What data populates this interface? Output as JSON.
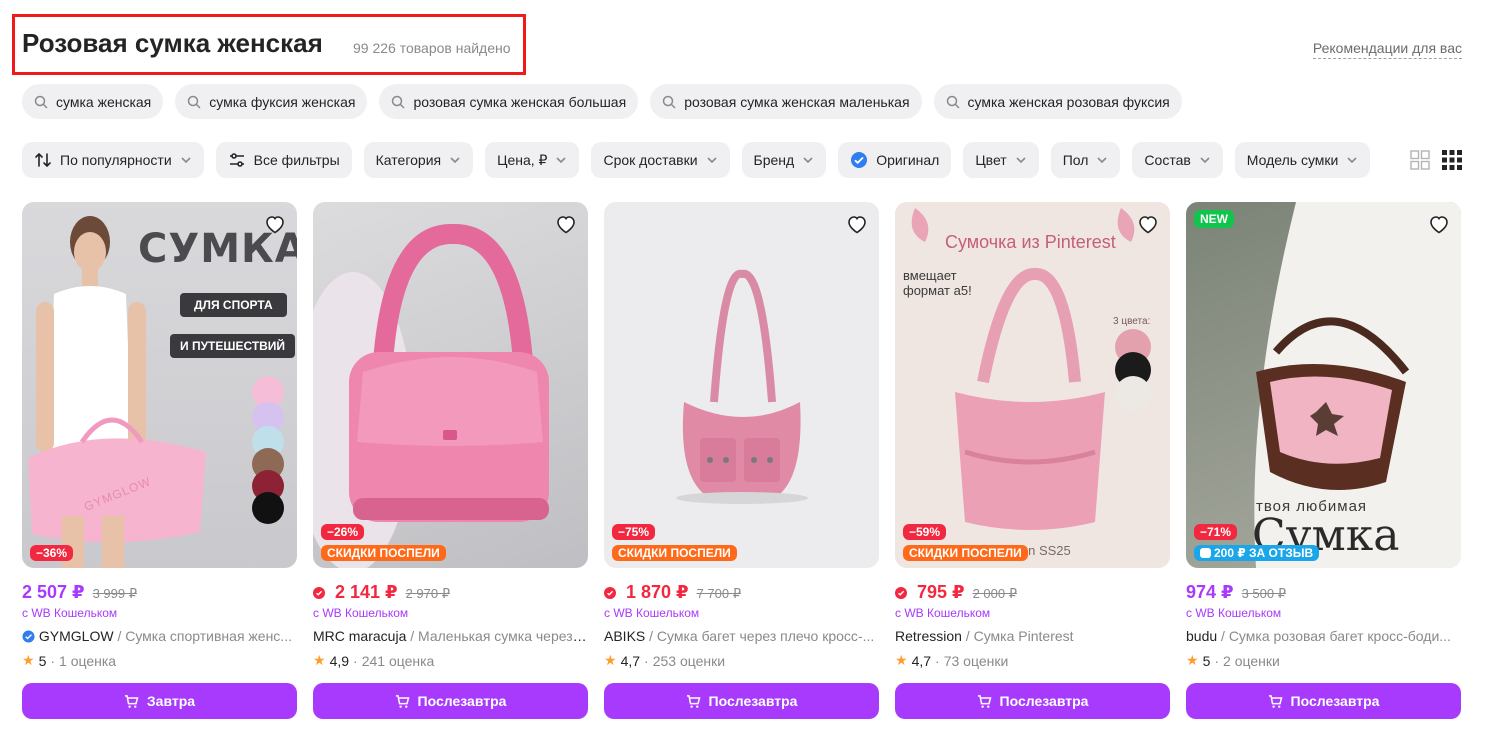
{
  "header": {
    "title": "Розовая сумка женская",
    "count": "99 226 товаров найдено",
    "recommendations": "Рекомендации для вас"
  },
  "suggestions": [
    "сумка женская",
    "сумка фуксия женская",
    "розовая сумка женская большая",
    "розовая сумка женская маленькая",
    "сумка женская розовая фуксия"
  ],
  "filters": {
    "sort": "По популярности",
    "all": "Все фильтры",
    "category": "Категория",
    "price": "Цена, ₽",
    "delivery": "Срок доставки",
    "brand": "Бренд",
    "original": "Оригинал",
    "color": "Цвет",
    "gender": "Пол",
    "composition": "Состав",
    "model": "Модель сумки"
  },
  "colors": {
    "accent": "#a73afd",
    "sale": "#f1283f",
    "promo": "#ff6a1a"
  },
  "products": [
    {
      "discount": "−36%",
      "promo": "",
      "price": "2 507 ₽",
      "old_price": "3 999 ₽",
      "wallet": "с WB Кошельком",
      "brand": "GYMGLOW",
      "name": " / Сумка спортивная женс...",
      "rating": "5",
      "reviews": "1 оценка",
      "delivery": "Завтра",
      "badge_new": ""
    },
    {
      "discount": "−26%",
      "promo": "СКИДКИ ПОСПЕЛИ",
      "price": "2 141 ₽",
      "old_price": "2 970 ₽",
      "wallet": "с WB Кошельком",
      "brand": "MRC maracuja",
      "name": " / Маленькая сумка через ...",
      "rating": "4,9",
      "reviews": "241 оценка",
      "delivery": "Послезавтра",
      "badge_new": ""
    },
    {
      "discount": "−75%",
      "promo": "СКИДКИ ПОСПЕЛИ",
      "price": "1 870 ₽",
      "old_price": "7 700 ₽",
      "wallet": "с WB Кошельком",
      "brand": "ABIKS",
      "name": " / Сумка багет через плечо кросс-...",
      "rating": "4,7",
      "reviews": "253 оценки",
      "delivery": "Послезавтра",
      "badge_new": ""
    },
    {
      "discount": "−59%",
      "promo": "СКИДКИ ПОСПЕЛИ",
      "price": "795 ₽",
      "old_price": "2 000 ₽",
      "wallet": "с WB Кошельком",
      "brand": "Retression",
      "name": " / Сумка Pinterest",
      "rating": "4,7",
      "reviews": "73 оценки",
      "delivery": "Послезавтра",
      "badge_new": "",
      "image_text": {
        "title": "Сумочка из Pinterest",
        "note": "вмещает формат а5!",
        "colors_label": "3 цвета:",
        "footer": "ssion SS25"
      }
    },
    {
      "discount": "−71%",
      "promo": "200 ₽ ЗА ОТЗЫВ",
      "price": "974 ₽",
      "old_price": "3 500 ₽",
      "wallet": "с WB Кошельком",
      "brand": "budu",
      "name": " / Сумка розовая багет кросс-боди...",
      "rating": "5",
      "reviews": "2 оценки",
      "delivery": "Послезавтра",
      "badge_new": "NEW",
      "image_text": {
        "tagline": "твоя любимая",
        "word": "Сумка"
      }
    }
  ],
  "card1_image_text": {
    "word": "СУМКА",
    "tag1": "ДЛЯ СПОРТА",
    "tag2": "И ПУТЕШЕСТВИЙ",
    "bag_logo": "GYMGLOW"
  }
}
